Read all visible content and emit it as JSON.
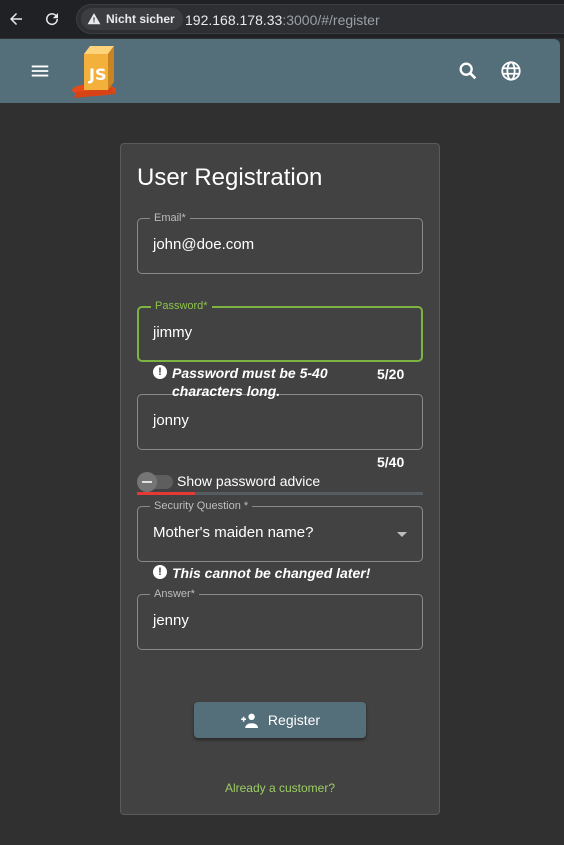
{
  "browser": {
    "security_label": "Nicht sicher",
    "url_host": "192.168.178.33",
    "url_rest": ":3000/#/register"
  },
  "toolbar": {
    "menu_icon": "menu-icon",
    "logo": "juice-shop-logo",
    "search_icon": "search-icon",
    "language_icon": "globe-icon"
  },
  "form": {
    "title": "User Registration",
    "email": {
      "label": "Email*",
      "value": "john@doe.com"
    },
    "password": {
      "label": "Password*",
      "value": "jimmy",
      "hint": "Password must be 5-40 characters long.",
      "counter": "5/20"
    },
    "repeat_password": {
      "value": "jonny",
      "counter": "5/40"
    },
    "advice_toggle": {
      "label": "Show password advice",
      "checked": false
    },
    "security_question": {
      "label": "Security Question *",
      "value": "Mother's maiden name?"
    },
    "security_hint": "This cannot be changed later!",
    "answer": {
      "label": "Answer*",
      "value": "jenny"
    },
    "register_label": "Register",
    "customer_link": "Already a customer?"
  },
  "colors": {
    "toolbar": "#546e7a",
    "focus": "#7cb342",
    "link": "#9ccc65",
    "toggle_underline": "#e53935"
  }
}
